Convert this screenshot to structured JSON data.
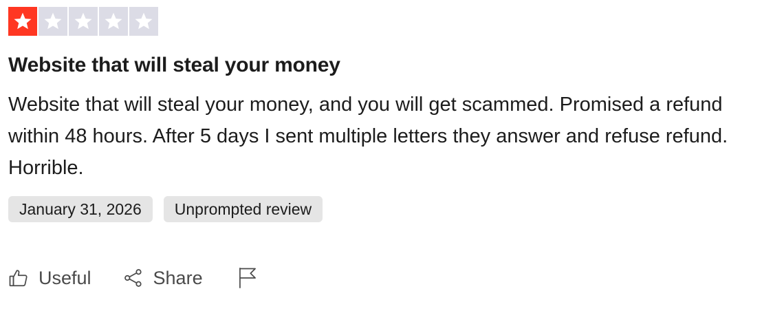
{
  "rating": {
    "value": 1,
    "max": 5,
    "filled_color": "#ff3722",
    "empty_color": "#dcdce6",
    "star_color": "#ffffff"
  },
  "review": {
    "title": "Website that will steal your money",
    "body": "Website that will steal your money, and you will get scammed. Promised a refund within 48 hours. After 5 days I sent multiple letters they answer and refuse refund. Horrible.",
    "date": "January 31, 2026",
    "tag": "Unprompted review"
  },
  "actions": {
    "useful_label": "Useful",
    "useful_icon": "thumbs-up-icon",
    "share_label": "Share",
    "share_icon": "share-icon",
    "flag_icon": "flag-icon"
  }
}
